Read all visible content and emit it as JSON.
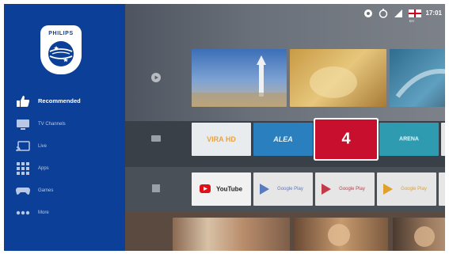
{
  "brand": {
    "name": "PHILIPS"
  },
  "sidebar": {
    "items": [
      {
        "label": "Recommended",
        "icon": "thumbs-up-icon",
        "active": true
      },
      {
        "label": "TV Channels",
        "icon": "tv-channels-icon",
        "active": false
      },
      {
        "label": "Live",
        "icon": "cast-icon",
        "active": false
      },
      {
        "label": "Apps",
        "icon": "apps-grid-icon",
        "active": false
      },
      {
        "label": "Games",
        "icon": "gamepad-icon",
        "active": false
      },
      {
        "label": "More",
        "icon": "more-dots-icon",
        "active": false
      }
    ]
  },
  "status_bar": {
    "icons": [
      "settings-icon",
      "timer-icon",
      "wifi-icon",
      "uk-flag-icon"
    ],
    "wifi_sublabel": "BH",
    "time": "17:01"
  },
  "rows": {
    "featured": {
      "icon": "play-circle-icon"
    },
    "channels": {
      "icon": "channels-row-icon",
      "tiles": [
        {
          "label": "VIRA HD",
          "bg": "#e9ecee",
          "fg": "#e8a24a"
        },
        {
          "label": "ALEA",
          "bg": "#2a7fbf",
          "fg": "#e8f3fb"
        },
        {
          "label": "4",
          "bg": "#c8102e",
          "fg": "#ffffff"
        },
        {
          "label": "ARENA",
          "bg": "#2e9bb0",
          "fg": "#e6f6f8"
        }
      ]
    },
    "apps": {
      "icon": "apps-row-icon",
      "tiles": [
        {
          "label": "YouTube",
          "bg": "#f1f1f1",
          "fg": "#222222"
        },
        {
          "label": "Google Play",
          "bg": "#e6e6e6",
          "fg": "#5a7ac0"
        },
        {
          "label": "Google Play",
          "bg": "#e6e6e6",
          "fg": "#c23b4a"
        },
        {
          "label": "Google Play",
          "bg": "#e6e6e6",
          "fg": "#e0a12a"
        }
      ]
    }
  },
  "colors": {
    "sidebar": "#0c3f97",
    "accent_red": "#c8102e"
  }
}
